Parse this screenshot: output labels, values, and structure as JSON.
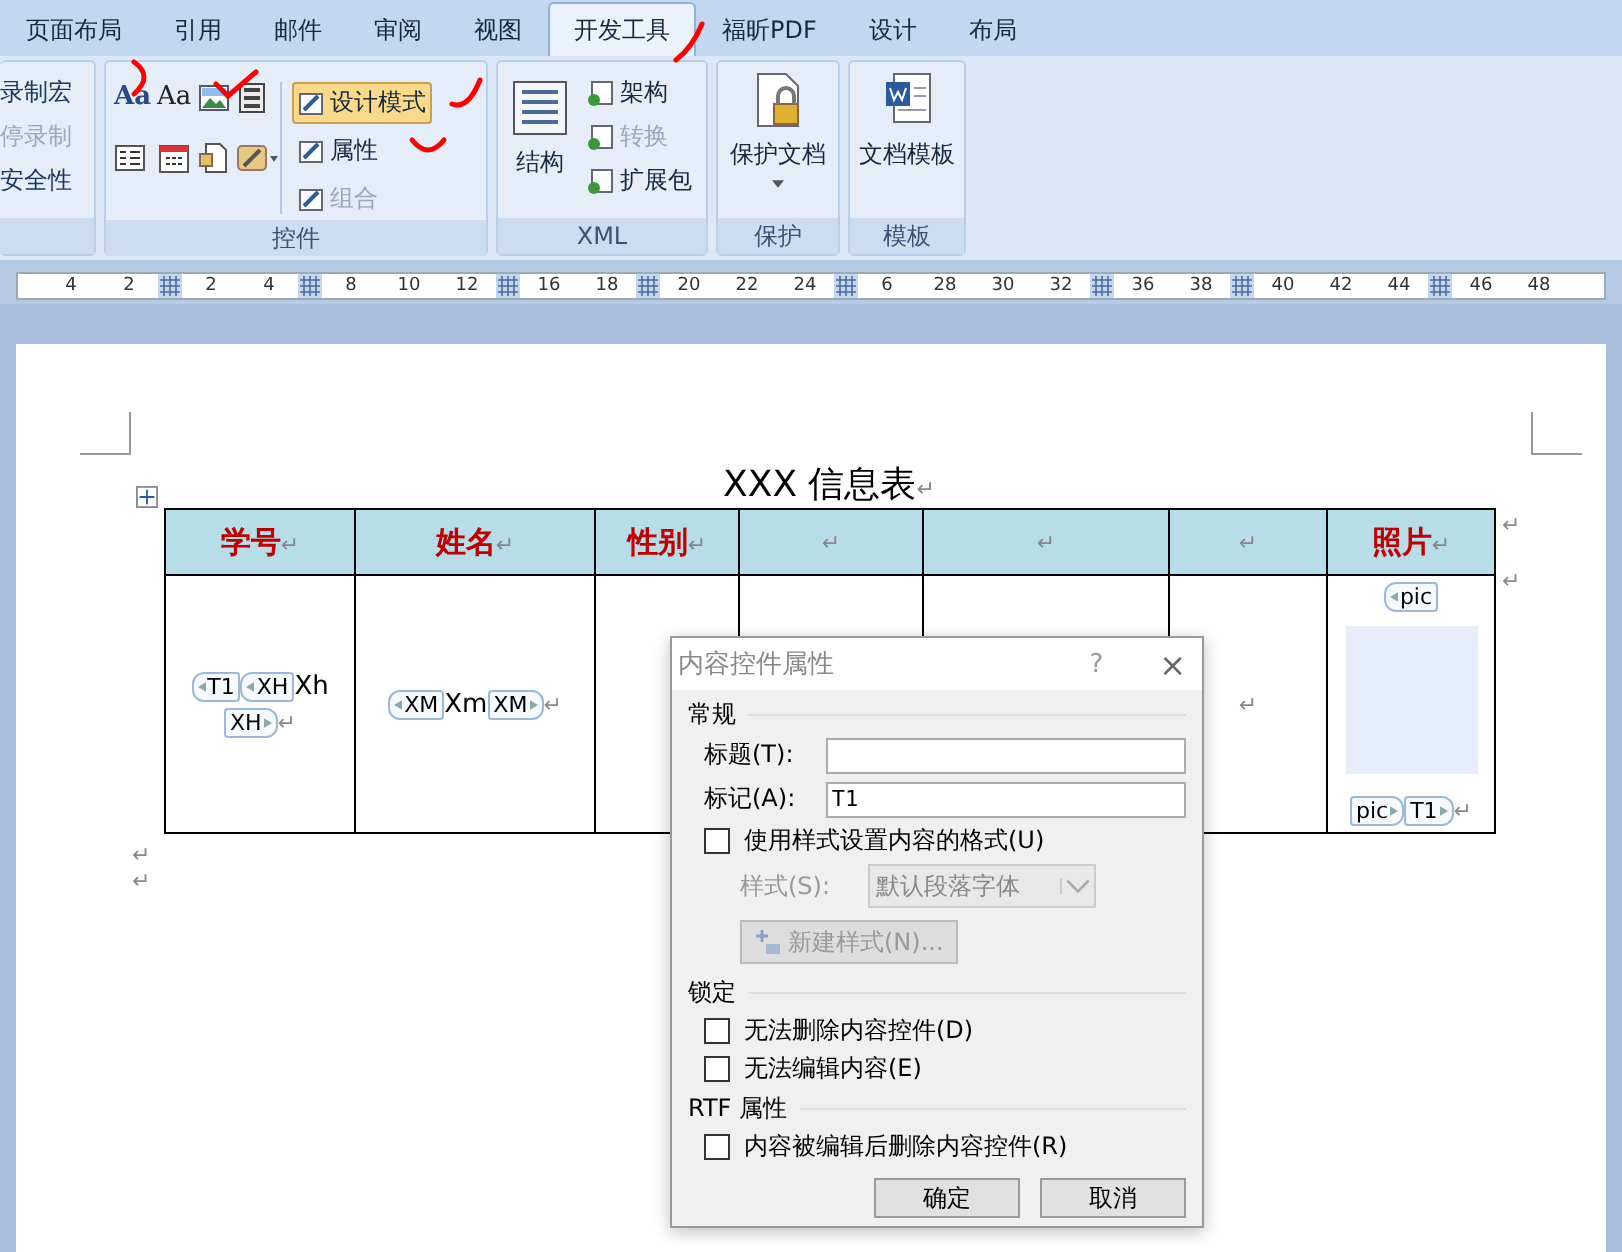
{
  "tabs": [
    {
      "label": "页面布局",
      "selected": false
    },
    {
      "label": "引用",
      "selected": false
    },
    {
      "label": "邮件",
      "selected": false
    },
    {
      "label": "审阅",
      "selected": false
    },
    {
      "label": "视图",
      "selected": false
    },
    {
      "label": "开发工具",
      "selected": true
    },
    {
      "label": "福昕PDF",
      "selected": false
    },
    {
      "label": "设计",
      "selected": false
    },
    {
      "label": "布局",
      "selected": false
    }
  ],
  "macro_group": {
    "items": [
      {
        "label": "录制宏",
        "disabled": false
      },
      {
        "label": "停录制",
        "disabled": true
      },
      {
        "label": "安全性",
        "disabled": false
      }
    ]
  },
  "controls_group": {
    "label": "控件",
    "rich_text_glyph": "Aa",
    "plain_text_glyph": "Aa",
    "buttons": [
      {
        "label": "设计模式",
        "selected": true,
        "disabled": false
      },
      {
        "label": "属性",
        "selected": false,
        "disabled": false
      },
      {
        "label": "组合",
        "selected": false,
        "disabled": true
      }
    ]
  },
  "xml_group": {
    "label": "XML",
    "large_button": "结构",
    "buttons": [
      {
        "label": "架构",
        "disabled": false
      },
      {
        "label": "转换",
        "disabled": true
      },
      {
        "label": "扩展包",
        "disabled": false
      }
    ]
  },
  "protect_group": {
    "label": "保护",
    "button": "保护文档"
  },
  "template_group": {
    "label": "模板",
    "button": "文档模板"
  },
  "ruler": [
    {
      "kind": "number",
      "text": "4"
    },
    {
      "kind": "number",
      "text": "2"
    },
    {
      "kind": "grid"
    },
    {
      "kind": "number",
      "text": "2"
    },
    {
      "kind": "number",
      "text": "4"
    },
    {
      "kind": "grid"
    },
    {
      "kind": "number",
      "text": "8"
    },
    {
      "kind": "number",
      "text": "10"
    },
    {
      "kind": "number",
      "text": "12"
    },
    {
      "kind": "grid"
    },
    {
      "kind": "number",
      "text": "16"
    },
    {
      "kind": "number",
      "text": "18"
    },
    {
      "kind": "grid"
    },
    {
      "kind": "number",
      "text": "20"
    },
    {
      "kind": "number",
      "text": "22"
    },
    {
      "kind": "number",
      "text": "24"
    },
    {
      "kind": "grid"
    },
    {
      "kind": "number",
      "text": "6"
    },
    {
      "kind": "number",
      "text": "28"
    },
    {
      "kind": "number",
      "text": "30"
    },
    {
      "kind": "number",
      "text": "32"
    },
    {
      "kind": "grid"
    },
    {
      "kind": "number",
      "text": "36"
    },
    {
      "kind": "number",
      "text": "38"
    },
    {
      "kind": "grid"
    },
    {
      "kind": "number",
      "text": "40"
    },
    {
      "kind": "number",
      "text": "42"
    },
    {
      "kind": "number",
      "text": "44"
    },
    {
      "kind": "grid"
    },
    {
      "kind": "number",
      "text": "46"
    },
    {
      "kind": "number",
      "text": "48"
    }
  ],
  "document": {
    "title": "XXX 信息表",
    "title_mark": "↵",
    "table": {
      "columns": [
        {
          "text": "学号",
          "mark": "↵",
          "body_lines": [
            [
              {
                "kind": "tag_start",
                "text": "T1"
              },
              {
                "kind": "tag_start",
                "text": "XH"
              },
              {
                "kind": "text",
                "text": "Xh"
              }
            ],
            [
              {
                "kind": "tag_end",
                "text": "XH"
              },
              {
                "kind": "mark",
                "text": "↵"
              }
            ]
          ]
        },
        {
          "text": "姓名",
          "mark": "↵",
          "body_lines": [
            [
              {
                "kind": "tag_start",
                "text": "XM"
              },
              {
                "kind": "text",
                "text": "Xm"
              },
              {
                "kind": "tag_end",
                "text": "XM"
              },
              {
                "kind": "mark",
                "text": "↵"
              }
            ]
          ]
        },
        {
          "text": "性别",
          "mark": "↵"
        },
        {
          "mark": "↵"
        },
        {
          "mark": "↵"
        },
        {
          "mark": "↵",
          "body_lines": [
            [
              {
                "kind": "mark",
                "text": "↵"
              }
            ]
          ]
        },
        {
          "text": "照片",
          "mark": "↵",
          "body_lines": [
            [
              {
                "kind": "tag_start",
                "text": "pic"
              }
            ],
            [
              {
                "kind": "image"
              }
            ],
            [
              {
                "kind": "tag_end",
                "text": "pic"
              },
              {
                "kind": "tag_end",
                "text": "T1"
              },
              {
                "kind": "mark",
                "text": "↵"
              }
            ]
          ]
        }
      ],
      "header_row_mark": "↵",
      "body_row_mark": "↵"
    },
    "after_marks": [
      "↵",
      "↵"
    ]
  },
  "dialog": {
    "title": "内容控件属性",
    "help": "?",
    "close": "×",
    "general_section": "常规",
    "title_label": "标题(T):",
    "tag_label": "标记(A):",
    "tag_value": "T1",
    "use_style": {
      "label": "使用样式设置内容的格式(U)",
      "checked": false
    },
    "style_label": "样式(S):",
    "style_value": "默认段落字体",
    "new_style_button": "新建样式(N)...",
    "lock_section": "锁定",
    "lock_options": [
      {
        "label": "无法删除内容控件(D)",
        "checked": false
      },
      {
        "label": "无法编辑内容(E)",
        "checked": false
      }
    ],
    "rtf_section": "RTF 属性",
    "rtf_option": {
      "label": "内容被编辑后删除内容控件(R)",
      "checked": false
    },
    "ok": "确定",
    "cancel": "取消"
  }
}
